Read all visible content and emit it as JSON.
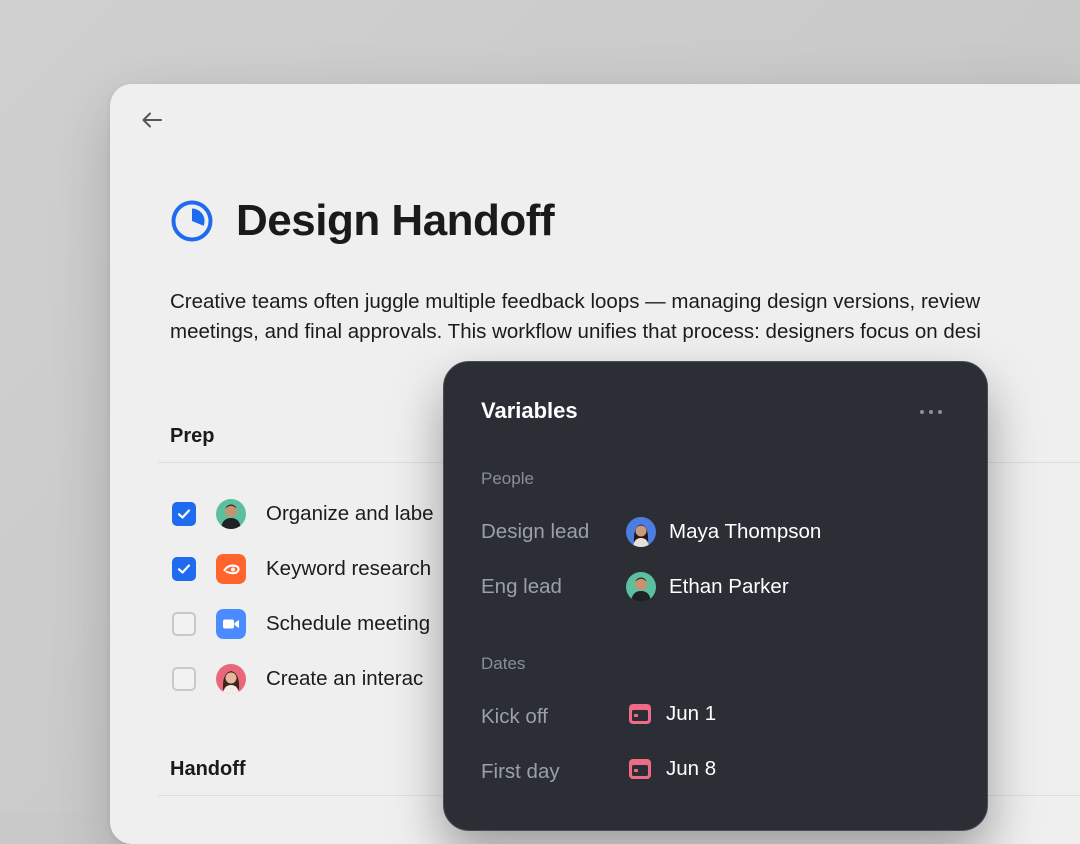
{
  "page": {
    "title": "Design Handoff",
    "description": [
      "Creative teams often juggle multiple feedback loops — managing design versions, review",
      "meetings, and final approvals. This workflow unifies that process: designers focus on desi"
    ],
    "title_icon": "pie-chart-icon",
    "back_icon": "arrow-left-icon",
    "accent_color": "#1e6bf0"
  },
  "prep": {
    "heading": "Prep",
    "tasks": [
      {
        "label": "Organize and labe",
        "checked": true,
        "icon": "avatar-man"
      },
      {
        "label": "Keyword research",
        "checked": true,
        "icon": "semrush-icon"
      },
      {
        "label": "Schedule meeting",
        "checked": false,
        "icon": "zoom-icon"
      },
      {
        "label": "Create an interac",
        "checked": false,
        "icon": "avatar-woman"
      }
    ]
  },
  "handoff": {
    "heading": "Handoff"
  },
  "variables": {
    "title": "Variables",
    "more_icon": "more-horizontal-icon",
    "people": {
      "label": "People",
      "items": [
        {
          "label": "Design lead",
          "value": "Maya Thompson"
        },
        {
          "label": "Eng lead",
          "value": "Ethan Parker"
        }
      ]
    },
    "dates": {
      "label": "Dates",
      "items": [
        {
          "label": "Kick off",
          "value": "Jun 1"
        },
        {
          "label": "First day",
          "value": "Jun 8"
        }
      ]
    }
  }
}
